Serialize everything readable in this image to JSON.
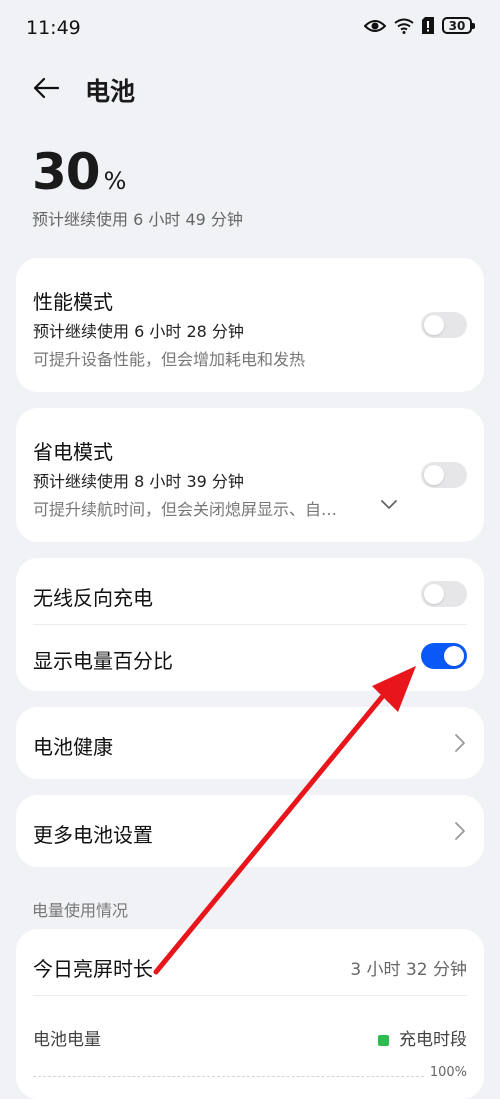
{
  "status": {
    "time": "11:49",
    "battery": "30"
  },
  "header": {
    "title": "电池"
  },
  "battery": {
    "percent": "30",
    "percent_sign": "%",
    "remaining": "预计继续使用 6 小时 49 分钟"
  },
  "performance": {
    "title": "性能模式",
    "sub": "预计继续使用 6 小时 28 分钟",
    "desc": "可提升设备性能，但会增加耗电和发热",
    "enabled": false
  },
  "power_saving": {
    "title": "省电模式",
    "sub": "预计继续使用 8 小时 39 分钟",
    "desc": "可提升续航时间，但会关闭熄屏显示、自…",
    "enabled": false
  },
  "wireless_reverse": {
    "title": "无线反向充电",
    "enabled": false
  },
  "show_percentage": {
    "title": "显示电量百分比",
    "enabled": true
  },
  "battery_health": {
    "title": "电池健康"
  },
  "more_settings": {
    "title": "更多电池设置"
  },
  "usage": {
    "section_label": "电量使用情况",
    "screen_time_label": "今日亮屏时长",
    "screen_time_value": "3 小时 32 分钟",
    "battery_level_label": "电池电量",
    "legend_charging": "充电时段",
    "axis_top": "100%"
  },
  "colors": {
    "accent": "#0a59f7",
    "charging": "#2dbd4e",
    "annotation_arrow": "#e8161b"
  }
}
